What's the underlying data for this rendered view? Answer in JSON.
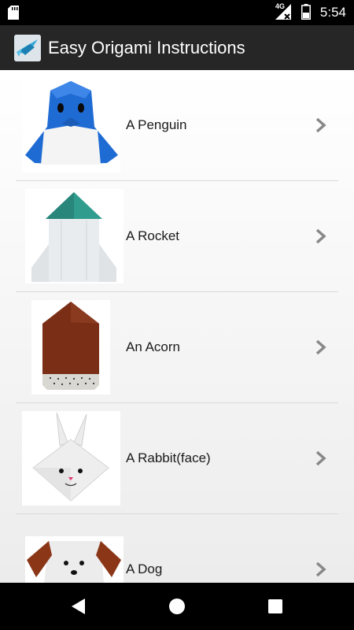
{
  "status_bar": {
    "network": "4G",
    "time": "5:54",
    "icons": [
      "sd-card-icon",
      "signal-icon",
      "battery-icon"
    ]
  },
  "app_bar": {
    "title": "Easy Origami Instructions",
    "logo_icon": "origami-crane-icon"
  },
  "items": [
    {
      "label": "A Penguin",
      "image": "penguin-origami"
    },
    {
      "label": "A Rocket",
      "image": "rocket-origami"
    },
    {
      "label": "An Acorn",
      "image": "acorn-origami"
    },
    {
      "label": "A Rabbit(face)",
      "image": "rabbit-face-origami"
    },
    {
      "label": "A Dog",
      "image": "dog-origami"
    }
  ],
  "nav_bar": {
    "icons": [
      "back-icon",
      "home-icon",
      "recents-icon"
    ]
  },
  "colors": {
    "status_bar": "#000000",
    "app_bar": "#262626",
    "list_background": "#f4f4f4",
    "chevron": "#888888"
  }
}
